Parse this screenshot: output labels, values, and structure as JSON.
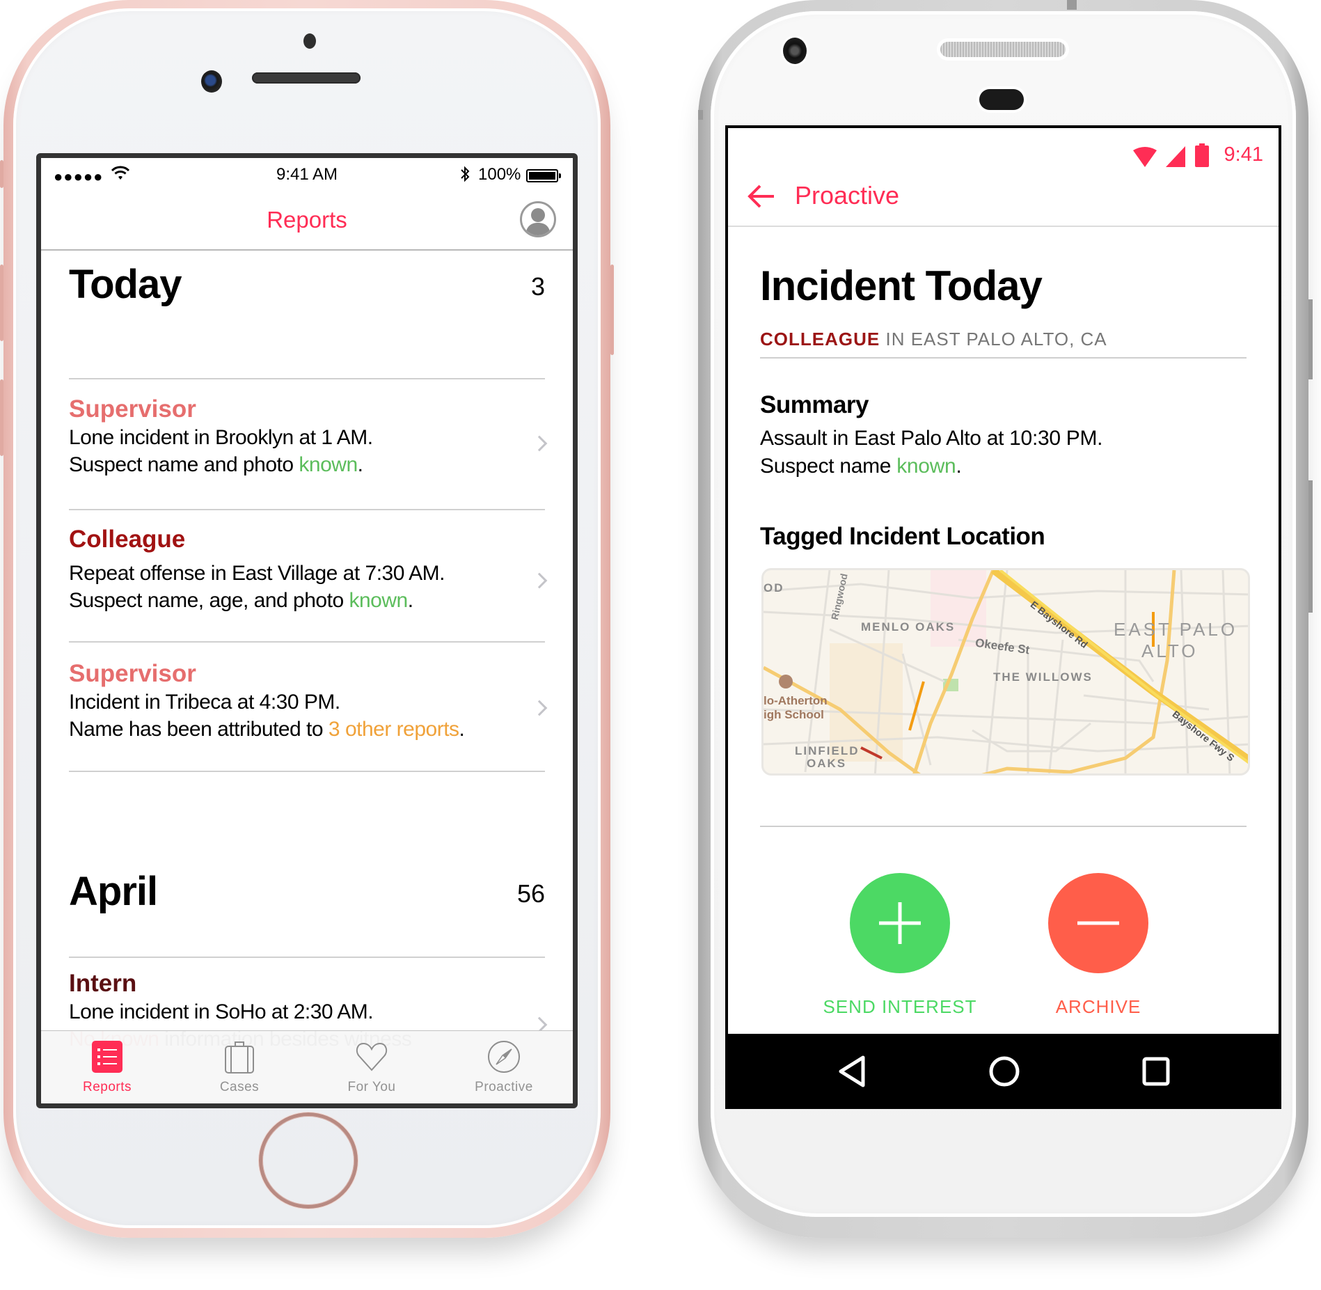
{
  "ios": {
    "status": {
      "signal": "●●●●●",
      "time": "9:41 AM",
      "battery_percent": "100%",
      "bluetooth": "✱"
    },
    "nav": {
      "title": "Reports",
      "profile_icon": "user-silhouette-icon"
    },
    "sections": [
      {
        "title": "Today",
        "count": "3",
        "reports": [
          {
            "role": "Supervisor",
            "line1": "Lone incident in Brooklyn at 1 AM.",
            "line2_prefix": "Suspect name and photo ",
            "line2_highlight": "known",
            "line2_suffix": "."
          },
          {
            "role": "Colleague",
            "line1": "Repeat offense in East Village at 7:30 AM.",
            "line2_prefix": "Suspect name, age, and photo ",
            "line2_highlight": "known",
            "line2_suffix": "."
          },
          {
            "role": "Supervisor",
            "line1": "Incident in Tribeca at 4:30 PM.",
            "line2_prefix": "Name has been attributed to ",
            "line2_highlight": "3 other reports",
            "line2_suffix": "."
          }
        ]
      },
      {
        "title": "April",
        "count": "56",
        "reports": [
          {
            "role": "Intern",
            "line1": "Lone incident in SoHo at 2:30 AM.",
            "line2_prefix": "",
            "line2_highlight": "No known",
            "line2_suffix": " information besides witness"
          }
        ]
      }
    ],
    "tabs": [
      {
        "label": "Reports",
        "icon": "list-icon",
        "active": true
      },
      {
        "label": "Cases",
        "icon": "briefcase-icon",
        "active": false
      },
      {
        "label": "For You",
        "icon": "heart-icon",
        "active": false
      },
      {
        "label": "Proactive",
        "icon": "compass-icon",
        "active": false
      }
    ]
  },
  "android": {
    "status": {
      "time": "9:41"
    },
    "toolbar": {
      "title": "Proactive",
      "back_icon": "arrow-back-icon"
    },
    "incident": {
      "title": "Incident Today",
      "role": "COLLEAGUE",
      "location": "IN EAST PALO ALTO, CA",
      "summary_heading": "Summary",
      "summary_line1": "Assault in East Palo Alto at 10:30 PM.",
      "summary_line2_prefix": "Suspect name ",
      "summary_line2_highlight": "known",
      "summary_line2_suffix": ".",
      "location_heading": "Tagged Incident Location"
    },
    "map": {
      "labels": {
        "menlo_oaks": "MENLO OAKS",
        "east_palo": "EAST PALO",
        "alto": "ALTO",
        "the_willows": "THE WILLOWS",
        "okeefe": "Okeefe St",
        "bayshore_rd": "E Bayshore Rd",
        "bayshore_fwy": "Bayshore Fwy S",
        "ringwood": "Ringwood",
        "school1": "lo-Atherton",
        "school2": "igh School",
        "linfield1": "LINFIELD",
        "linfield2": "OAKS",
        "od": "OD"
      }
    },
    "actions": [
      {
        "label": "SEND INTEREST",
        "icon": "plus-icon",
        "color": "#4cd964"
      },
      {
        "label": "ARCHIVE",
        "icon": "minus-icon",
        "color": "#ff5e4a"
      }
    ]
  },
  "colors": {
    "accent": "#ff2d55",
    "supervisor": "#e66e6e",
    "colleague": "#a11212",
    "intern": "#5a0f12",
    "known_green": "#5cbd5c",
    "reports_orange": "#f0a23a"
  }
}
